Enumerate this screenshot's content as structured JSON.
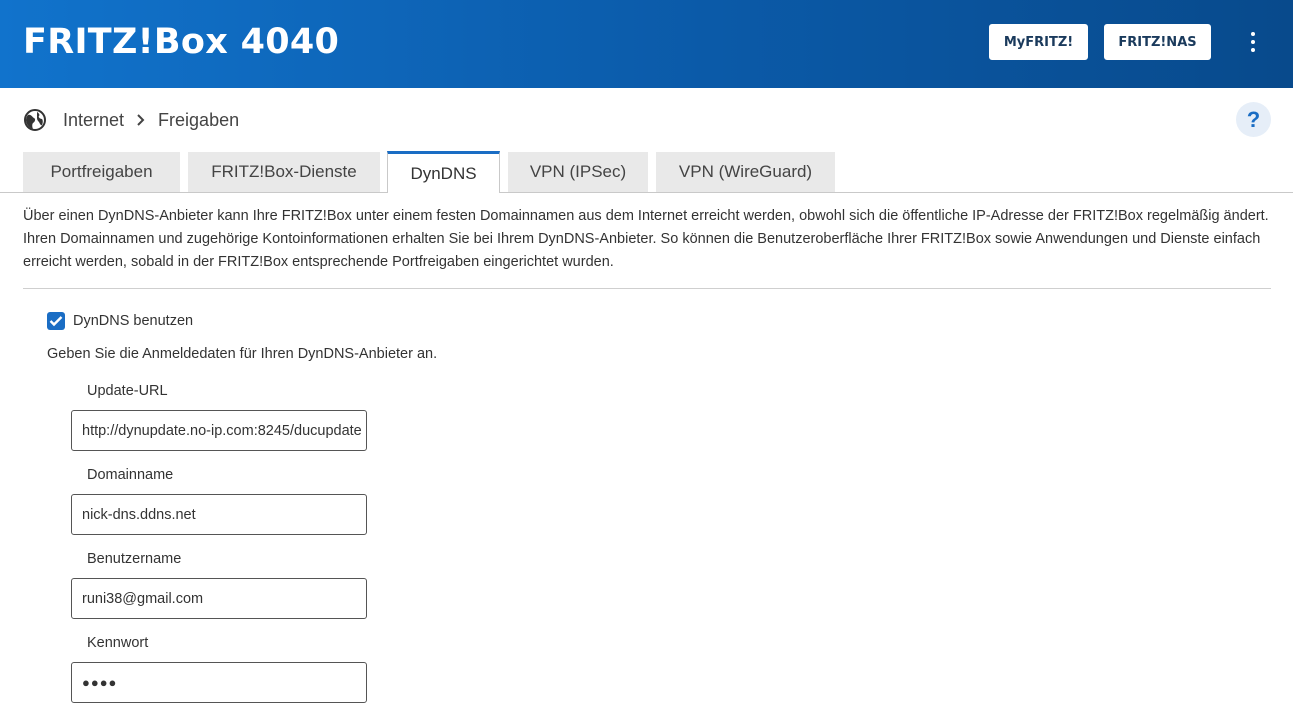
{
  "header": {
    "brand": "FRITZ!Box 4040",
    "myfritz_label": "MyFRITZ!",
    "nas_label": "FRITZ!NAS",
    "menu_icon": "kebab-menu-icon"
  },
  "breadcrumb": {
    "icon": "globe-icon",
    "items": [
      "Internet",
      "Freigaben"
    ],
    "help_label": "?"
  },
  "tabs": [
    {
      "label": "Portfreigaben",
      "active": false
    },
    {
      "label": "FRITZ!Box-Dienste",
      "active": false
    },
    {
      "label": "DynDNS",
      "active": true
    },
    {
      "label": "VPN (IPSec)",
      "active": false
    },
    {
      "label": "VPN (WireGuard)",
      "active": false
    }
  ],
  "intro": "Über einen DynDNS-Anbieter kann Ihre FRITZ!Box unter einem festen Domainnamen aus dem Internet erreicht werden, obwohl sich die öffentliche IP-Adresse der FRITZ!Box regelmäßig ändert. Ihren Domainnamen und zugehörige Kontoinformationen erhalten Sie bei Ihrem DynDNS-Anbieter. So können die Benutzeroberfläche Ihrer FRITZ!Box sowie Anwendungen und Dienste einfach erreicht werden, sobald in der FRITZ!Box entsprechende Portfreigaben eingerichtet wurden.",
  "form": {
    "use_dyndns_label": "DynDNS benutzen",
    "use_dyndns_checked": true,
    "hint": "Geben Sie die Anmeldedaten für Ihren DynDNS-Anbieter an.",
    "fields": {
      "update_url": {
        "label": "Update-URL",
        "value": "http://dynupdate.no-ip.com:8245/ducupdate"
      },
      "domain": {
        "label": "Domainname",
        "value": "nick-dns.ddns.net"
      },
      "user": {
        "label": "Benutzername",
        "value": "runi38@gmail.com"
      },
      "password": {
        "label": "Kennwort",
        "value": "●●●●"
      }
    }
  },
  "colors": {
    "header_start": "#1173cc",
    "header_end": "#084a8c",
    "accent": "#1a6dc4"
  }
}
